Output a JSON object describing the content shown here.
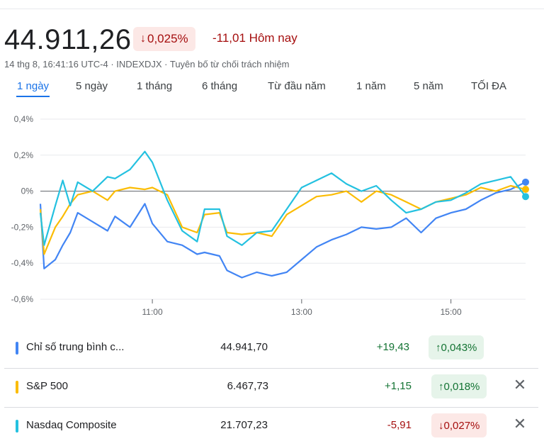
{
  "quote": {
    "price": "44.911,26",
    "change_percent": "0,025%",
    "change_direction": "down",
    "change_today": "-11,01 Hôm nay",
    "meta": "14 thg 8, 16:41:16 UTC-4 · INDEXDJX · Tuyên bố từ chối trách nhiệm"
  },
  "tabs": [
    {
      "label": "1 ngày",
      "active": true
    },
    {
      "label": "5 ngày"
    },
    {
      "label": "1 tháng"
    },
    {
      "label": "6 tháng"
    },
    {
      "label": "Từ đầu năm"
    },
    {
      "label": "1 năm"
    },
    {
      "label": "5 năm"
    },
    {
      "label": "TỐI ĐA"
    }
  ],
  "chart_data": {
    "type": "line",
    "y_unit": "%",
    "ylim": [
      -0.6,
      0.4
    ],
    "y_ticks": [
      "0,4%",
      "0,2%",
      "0%",
      "-0,2%",
      "-0,4%",
      "-0,6%"
    ],
    "x_ticks": [
      "11:00",
      "13:00",
      "15:00"
    ],
    "grid": true,
    "series": [
      {
        "name": "Chỉ số trung bình công nghiệp Dow Jones",
        "color": "#4285f4",
        "x": [
          9.5,
          9.55,
          9.7,
          9.8,
          9.9,
          10.0,
          10.2,
          10.4,
          10.5,
          10.7,
          10.9,
          11.0,
          11.2,
          11.4,
          11.6,
          11.7,
          11.9,
          12.0,
          12.2,
          12.4,
          12.6,
          12.8,
          13.0,
          13.2,
          13.4,
          13.6,
          13.8,
          14.0,
          14.2,
          14.4,
          14.6,
          14.8,
          15.0,
          15.2,
          15.4,
          15.6,
          15.8,
          16.0
        ],
        "y": [
          -0.07,
          -0.43,
          -0.38,
          -0.3,
          -0.23,
          -0.12,
          -0.17,
          -0.22,
          -0.14,
          -0.2,
          -0.07,
          -0.18,
          -0.28,
          -0.3,
          -0.35,
          -0.34,
          -0.36,
          -0.44,
          -0.48,
          -0.45,
          -0.47,
          -0.45,
          -0.38,
          -0.31,
          -0.27,
          -0.24,
          -0.2,
          -0.21,
          -0.2,
          -0.15,
          -0.23,
          -0.15,
          -0.12,
          -0.1,
          -0.05,
          -0.01,
          0.01,
          0.05
        ]
      },
      {
        "name": "S&P 500",
        "color": "#fbbc04",
        "x": [
          9.5,
          9.55,
          9.7,
          9.8,
          9.9,
          10.0,
          10.2,
          10.4,
          10.5,
          10.7,
          10.9,
          11.0,
          11.2,
          11.4,
          11.6,
          11.7,
          11.9,
          12.0,
          12.2,
          12.4,
          12.6,
          12.8,
          13.0,
          13.2,
          13.4,
          13.6,
          13.8,
          14.0,
          14.2,
          14.4,
          14.6,
          14.8,
          15.0,
          15.2,
          15.4,
          15.6,
          15.8,
          16.0
        ],
        "y": [
          -0.1,
          -0.35,
          -0.2,
          -0.14,
          -0.07,
          -0.02,
          0.0,
          -0.05,
          0.0,
          0.02,
          0.01,
          0.02,
          -0.02,
          -0.2,
          -0.23,
          -0.13,
          -0.12,
          -0.23,
          -0.24,
          -0.23,
          -0.25,
          -0.13,
          -0.08,
          -0.03,
          -0.02,
          0.0,
          -0.06,
          0.0,
          -0.02,
          -0.06,
          -0.1,
          -0.06,
          -0.04,
          -0.02,
          0.02,
          0.0,
          0.03,
          0.01
        ]
      },
      {
        "name": "Nasdaq Composite",
        "color": "#24c1e0",
        "x": [
          9.5,
          9.55,
          9.7,
          9.8,
          9.9,
          10.0,
          10.2,
          10.4,
          10.5,
          10.7,
          10.9,
          11.0,
          11.2,
          11.4,
          11.6,
          11.7,
          11.9,
          12.0,
          12.2,
          12.4,
          12.6,
          12.8,
          13.0,
          13.2,
          13.4,
          13.6,
          13.8,
          14.0,
          14.2,
          14.4,
          14.6,
          14.8,
          15.0,
          15.2,
          15.4,
          15.6,
          15.8,
          16.0
        ],
        "y": [
          -0.12,
          -0.3,
          -0.08,
          0.06,
          -0.08,
          0.05,
          0.0,
          0.08,
          0.07,
          0.12,
          0.22,
          0.16,
          -0.05,
          -0.22,
          -0.28,
          -0.1,
          -0.1,
          -0.25,
          -0.3,
          -0.23,
          -0.22,
          -0.1,
          0.02,
          0.06,
          0.1,
          0.04,
          0.0,
          0.03,
          -0.05,
          -0.12,
          -0.1,
          -0.06,
          -0.05,
          -0.01,
          0.04,
          0.06,
          0.08,
          -0.03
        ]
      }
    ]
  },
  "compare": [
    {
      "name": "Chỉ số trung bình c...",
      "value": "44.941,70",
      "change": "+19,43",
      "percent": "0,043%",
      "direction": "up",
      "color": "#4285f4",
      "removable": false
    },
    {
      "name": "S&P 500",
      "value": "6.467,73",
      "change": "+1,15",
      "percent": "0,018%",
      "direction": "up",
      "color": "#fbbc04",
      "removable": true
    },
    {
      "name": "Nasdaq Composite",
      "value": "21.707,23",
      "change": "-5,91",
      "percent": "0,027%",
      "direction": "down",
      "color": "#24c1e0",
      "removable": true
    }
  ],
  "icons": {
    "arrow_up": "↑",
    "arrow_down": "↓",
    "close": "✕"
  },
  "colors": {
    "up": "#137333",
    "down": "#a50e0e",
    "accent": "#1a73e8"
  }
}
